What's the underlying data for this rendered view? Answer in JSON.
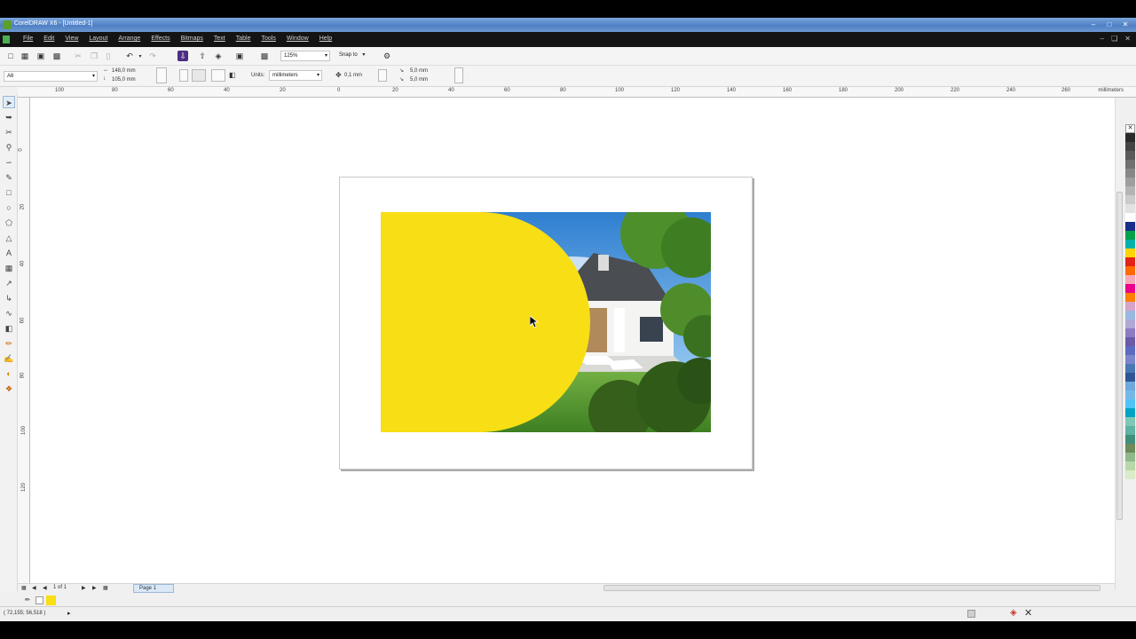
{
  "window": {
    "title": "CorelDRAW X6 - [Untitled-1]"
  },
  "menu": {
    "items": [
      "File",
      "Edit",
      "View",
      "Layout",
      "Arrange",
      "Effects",
      "Bitmaps",
      "Text",
      "Table",
      "Tools",
      "Window",
      "Help"
    ]
  },
  "toolbar": {
    "zoom": "125%",
    "snap_to": "Snap to"
  },
  "property_bar": {
    "page_size": "A6",
    "width": "148,0 mm",
    "height": "105,0 mm",
    "units_label": "Units:",
    "units": "millimeters",
    "nudge": "0,1 mm",
    "dup_x": "5,0 mm",
    "dup_y": "5,0 mm"
  },
  "ruler": {
    "h_labels": [
      "100",
      "80",
      "60",
      "40",
      "20",
      "0",
      "20",
      "40",
      "60",
      "80",
      "100",
      "120",
      "140",
      "160",
      "180",
      "200",
      "220",
      "240",
      "260"
    ],
    "unit": "millimeters",
    "v_labels": [
      "0",
      "20",
      "40",
      "60",
      "80",
      "100",
      "120"
    ]
  },
  "navigator": {
    "page_count": "1 of 1",
    "page_tab": "Page 1"
  },
  "status": {
    "coordinates": "( 72,155; 56,518 )"
  },
  "colors": {
    "accent_yellow": "#F8DE14"
  },
  "palette": [
    "#2b2b2b",
    "#444444",
    "#5a5a5a",
    "#707070",
    "#878787",
    "#9e9e9e",
    "#b4b4b4",
    "#cbcbcb",
    "#e2e2e2",
    "#ffffff",
    "#1a2d8c",
    "#00a14b",
    "#00b2a9",
    "#ffd400",
    "#e2231a",
    "#ff6a00",
    "#f7a8b8",
    "#ec008c",
    "#ff7f00",
    "#d7a3c9",
    "#9ab8e0",
    "#b0a9d6",
    "#8e7cc3",
    "#6a5aa8",
    "#5c6bc0",
    "#7986cb",
    "#4a78b5",
    "#2f5597",
    "#6fa8dc",
    "#74b9e6",
    "#4fc3f7",
    "#00a3c4",
    "#7ec8b5",
    "#5fb3a3",
    "#3f8f7a",
    "#6c8a5a",
    "#8fb98b",
    "#b7d8a8",
    "#d8ecc8"
  ],
  "icons": {
    "toolbox": [
      "pick-tool-icon",
      "shape-tool-icon",
      "crop-tool-icon",
      "zoom-tool-icon",
      "freehand-tool-icon",
      "smart-fill-icon",
      "rectangle-tool-icon",
      "ellipse-tool-icon",
      "polygon-tool-icon",
      "text-tool-icon",
      "table-tool-icon",
      "parallel-dimension-icon",
      "connector-tool-icon",
      "blend-tool-icon",
      "transparency-tool-icon",
      "eyedropper-icon",
      "outline-pen-icon",
      "fill-tool-icon",
      "interactive-fill-icon"
    ]
  }
}
